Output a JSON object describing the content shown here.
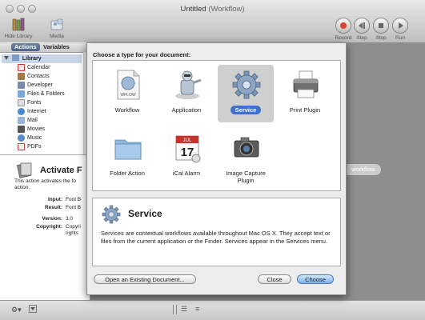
{
  "window": {
    "title": "Untitled",
    "mode": "(Workflow)"
  },
  "toolbar": {
    "hide_library": "Hide Library",
    "media": "Media",
    "record": "Record",
    "step": "Step",
    "stop": "Stop",
    "run": "Run"
  },
  "library_tabs": {
    "actions": "Actions",
    "variables": "Variables"
  },
  "library": {
    "root": "Library",
    "items": [
      "Calendar",
      "Contacts",
      "Developer",
      "Files & Folders",
      "Fonts",
      "Internet",
      "Mail",
      "Movies",
      "Music",
      "PDFs"
    ]
  },
  "description": {
    "title": "Activate F",
    "text": "This action activates the fo",
    "text2": "action.",
    "input_label": "Input:",
    "input_value": "Font B",
    "result_label": "Result:",
    "result_value": "Font B",
    "version_label": "Version:",
    "version_value": "3.0",
    "copyright_label": "Copyright:",
    "copyright_value": "Copyri",
    "copyright_value2": "rights"
  },
  "workflow_hint": "workflow.",
  "sheet": {
    "title": "Choose a type for your document:",
    "types": [
      {
        "label": "Workflow",
        "selected": false
      },
      {
        "label": "Application",
        "selected": false
      },
      {
        "label": "Service",
        "selected": true
      },
      {
        "label": "Print Plugin",
        "selected": false
      },
      {
        "label": "Folder Action",
        "selected": false
      },
      {
        "label": "iCal Alarm",
        "selected": false
      },
      {
        "label": "Image Capture Plugin",
        "selected": false
      }
    ],
    "wflow_text": "WFLOW",
    "ical_month": "JUL",
    "ical_day": "17",
    "info_title": "Service",
    "info_text": "Services are contextual workflows available throughout Mac OS X. They accept text or files from the current application or the Finder. Services appear in the Services menu.",
    "open_existing": "Open an Existing Document...",
    "close": "Close",
    "choose": "Choose"
  },
  "colors": {
    "accent": "#3f6fd1",
    "record": "#d9432f"
  }
}
